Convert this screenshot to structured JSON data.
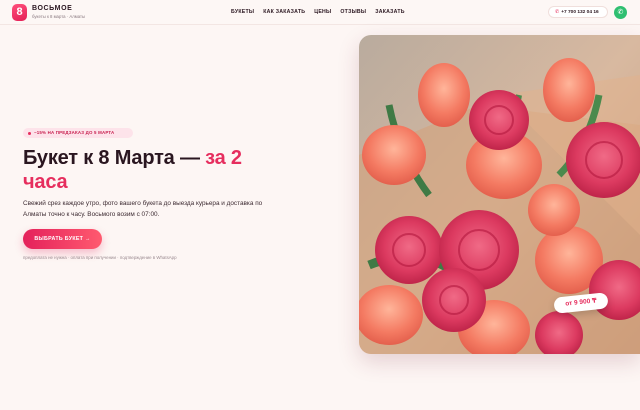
{
  "brand": {
    "badge": "8",
    "name": "ВОСЬМОЕ",
    "subtitle": "букеты к 8 марта · Алматы"
  },
  "nav": {
    "items": [
      "БУКЕТЫ",
      "КАК ЗАКАЗАТЬ",
      "ЦЕНЫ",
      "ОТЗЫВЫ",
      "ЗАКАЗАТЬ"
    ]
  },
  "header": {
    "phone": "+7 700 132 04 16",
    "phone_icon": "phone-icon",
    "whatsapp_icon": "whatsapp-icon"
  },
  "hero": {
    "promo": "−15% НА ПРЕДЗАКАЗ ДО 5 МАРТА",
    "title_main": "Букет к 8 Марта — ",
    "title_accent_1": "за 2",
    "title_accent_2": "часа",
    "description": "Свежий срез каждое утро, фото вашего букета до выезда курьера и доставка по Алматы точно к часу. Восьмого возим с 07:00.",
    "cta_label": "ВЫБРАТЬ БУКЕТ →",
    "footnote": "предоплата не нужна · оплата при получении · подтверждение в WhatsApp",
    "price": "от 9 900 ₸"
  },
  "colors": {
    "accent": "#e62e5e",
    "background": "#fdf6f4",
    "text": "#2a1620",
    "whatsapp": "#2fbf71"
  }
}
